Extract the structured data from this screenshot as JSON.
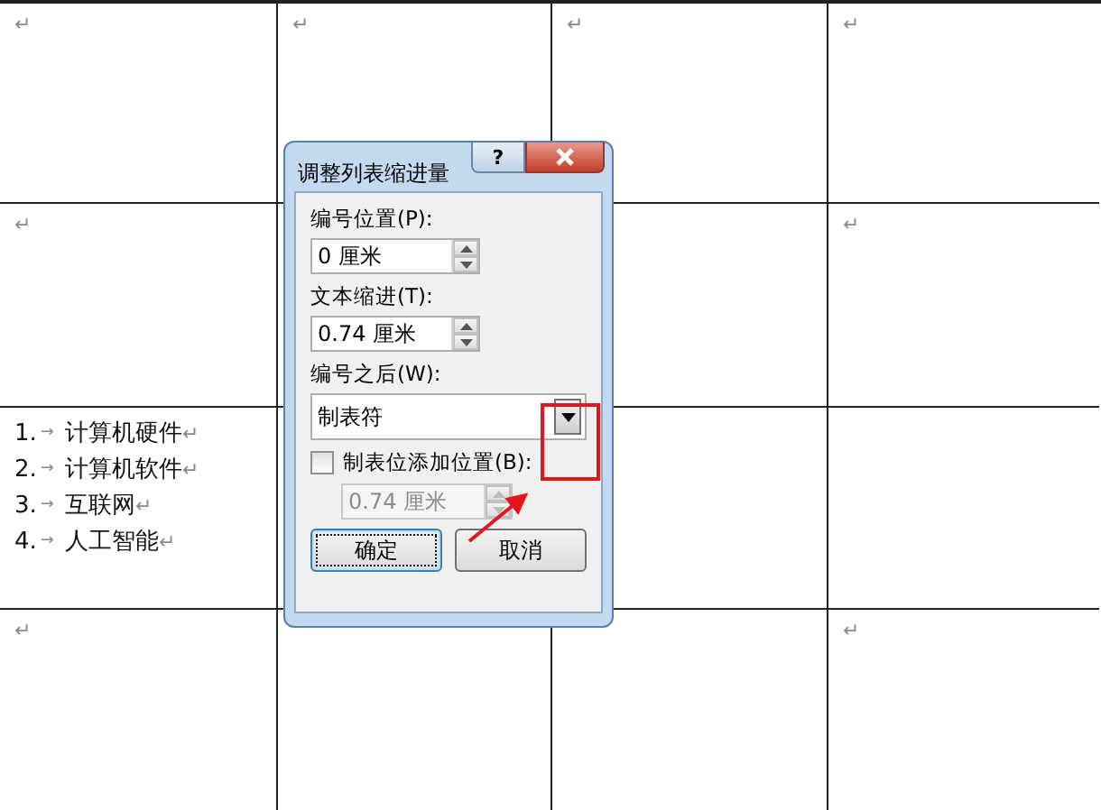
{
  "table": {
    "rows": [
      {
        "cells": [
          {
            "para_mark": "↵"
          },
          {
            "para_mark": "↵"
          },
          {
            "para_mark": "↵"
          },
          {
            "para_mark": "↵"
          }
        ]
      },
      {
        "cells": [
          {
            "para_mark": "↵"
          },
          {},
          {},
          {
            "para_mark": "↵"
          }
        ]
      },
      {
        "cells": [
          {
            "list": [
              {
                "number": "1.",
                "tab_mark": "→",
                "text": "计算机硬件",
                "para_mark": "↵"
              },
              {
                "number": "2.",
                "tab_mark": "→",
                "text": "计算机软件",
                "para_mark": "↵"
              },
              {
                "number": "3.",
                "tab_mark": "→",
                "text": "互联网",
                "para_mark": "↵"
              },
              {
                "number": "4.",
                "tab_mark": "→",
                "text": "人工智能",
                "para_mark": "↵"
              }
            ]
          },
          {},
          {},
          {}
        ]
      },
      {
        "cells": [
          {
            "para_mark": "↵"
          },
          {},
          {},
          {
            "para_mark": "↵"
          }
        ]
      }
    ]
  },
  "dialog": {
    "title": "调整列表缩进量",
    "help": "?",
    "fields": [
      {
        "kind": "spin",
        "label": "编号位置(P):",
        "value": "0 厘米"
      },
      {
        "kind": "spin",
        "label": "文本缩进(T):",
        "value": "0.74 厘米"
      },
      {
        "kind": "dropdown",
        "label": "编号之后(W):",
        "value": "制表符"
      },
      {
        "kind": "checkbox",
        "label": "制表位添加位置(B):",
        "checked": false
      },
      {
        "kind": "spin",
        "value": "0.74 厘米",
        "disabled": true
      }
    ],
    "buttons": [
      {
        "label": "确定",
        "default": true
      },
      {
        "label": "取消",
        "default": false
      }
    ]
  }
}
